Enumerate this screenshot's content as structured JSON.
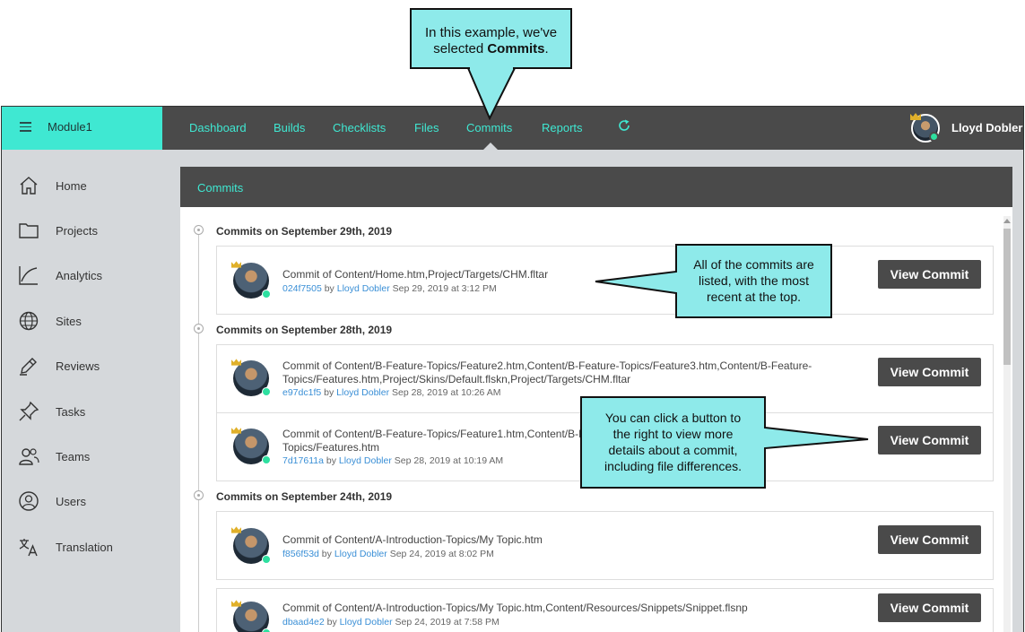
{
  "callouts": {
    "top": {
      "line1": "In this example, we've",
      "line2_pre": "selected ",
      "line2_bold": "Commits",
      "line2_post": "."
    },
    "middle": {
      "l1": "All of the commits are",
      "l2": "listed, with the most",
      "l3": "recent at the top."
    },
    "bottom": {
      "l1": "You can click a button to",
      "l2": "the right to view more",
      "l3": "details about a commit,",
      "l4": "including file differences."
    }
  },
  "topbar": {
    "module": "Module1",
    "nav": [
      "Dashboard",
      "Builds",
      "Checklists",
      "Files",
      "Commits",
      "Reports"
    ],
    "active": "Commits",
    "user_name": "Lloyd Dobler"
  },
  "sidebar": {
    "items": [
      {
        "label": "Home",
        "icon": "home-icon"
      },
      {
        "label": "Projects",
        "icon": "folder-icon"
      },
      {
        "label": "Analytics",
        "icon": "chart-icon"
      },
      {
        "label": "Sites",
        "icon": "globe-icon"
      },
      {
        "label": "Reviews",
        "icon": "pencil-icon"
      },
      {
        "label": "Tasks",
        "icon": "pin-icon"
      },
      {
        "label": "Teams",
        "icon": "team-icon"
      },
      {
        "label": "Users",
        "icon": "user-icon"
      },
      {
        "label": "Translation",
        "icon": "translate-icon"
      }
    ]
  },
  "panel": {
    "title": "Commits",
    "groups": [
      {
        "title": "Commits on September 29th, 2019",
        "commits": [
          {
            "message": "Commit of Content/Home.htm,Project/Targets/CHM.fltar",
            "hash": "024f7505",
            "by": "by",
            "author": "Lloyd Dobler",
            "date": "Sep 29, 2019 at 3:12 PM",
            "button": "View Commit"
          }
        ]
      },
      {
        "title": "Commits on September 28th, 2019",
        "commits": [
          {
            "message": "Commit of Content/B-Feature-Topics/Feature2.htm,Content/B-Feature-Topics/Feature3.htm,Content/B-Feature-Topics/Features.htm,Project/Skins/Default.flskn,Project/Targets/CHM.fltar",
            "hash": "e97dc1f5",
            "by": "by",
            "author": "Lloyd Dobler",
            "date": "Sep 28, 2019 at 10:26 AM",
            "button": "View Commit"
          },
          {
            "message": "Commit of Content/B-Feature-Topics/Feature1.htm,Content/B-Feature-Topics/Feature2.htm,Content/B-Feature-Topics/Features.htm",
            "hash": "7d17611a",
            "by": "by",
            "author": "Lloyd Dobler",
            "date": "Sep 28, 2019 at 10:19 AM",
            "button": "View Commit"
          }
        ]
      },
      {
        "title": "Commits on September 24th, 2019",
        "commits": [
          {
            "message": "Commit of Content/A-Introduction-Topics/My Topic.htm",
            "hash": "f856f53d",
            "by": "by",
            "author": "Lloyd Dobler",
            "date": "Sep 24, 2019 at 8:02 PM",
            "button": "View Commit"
          },
          {
            "message": "Commit of Content/A-Introduction-Topics/My Topic.htm,Content/Resources/Snippets/Snippet.flsnp",
            "hash": "dbaad4e2",
            "by": "by",
            "author": "Lloyd Dobler",
            "date": "Sep 24, 2019 at 7:58 PM",
            "button": "View Commit"
          }
        ]
      }
    ]
  },
  "colors": {
    "accent": "#3fe8d2",
    "dark": "#4a4a4a",
    "callout": "#8eeaea",
    "link": "#3a8fd6",
    "online": "#2ee0a0"
  }
}
